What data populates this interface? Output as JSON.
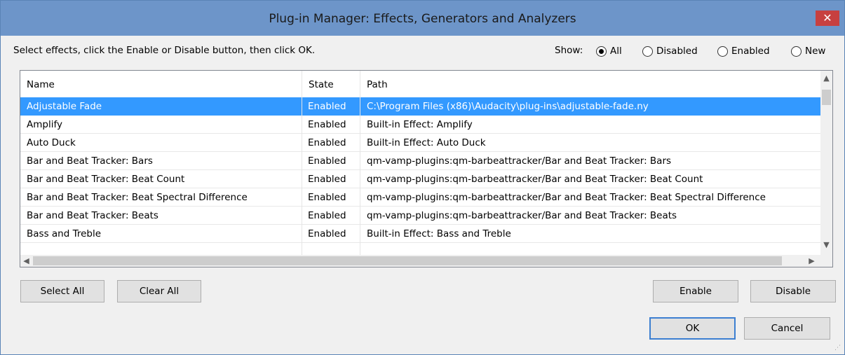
{
  "window": {
    "title": "Plug-in Manager: Effects, Generators and Analyzers",
    "close_glyph": "✕"
  },
  "instructions": "Select effects, click the Enable or Disable button, then click OK.",
  "show": {
    "label": "Show:",
    "options": [
      {
        "label": "All",
        "selected": true
      },
      {
        "label": "Disabled",
        "selected": false
      },
      {
        "label": "Enabled",
        "selected": false
      },
      {
        "label": "New",
        "selected": false
      }
    ]
  },
  "table": {
    "columns": [
      "Name",
      "State",
      "Path"
    ],
    "rows": [
      {
        "name": "Adjustable Fade",
        "state": "Enabled",
        "path": "C:\\Program Files (x86)\\Audacity\\plug-ins\\adjustable-fade.ny",
        "selected": true
      },
      {
        "name": "Amplify",
        "state": "Enabled",
        "path": "Built-in Effect: Amplify",
        "selected": false
      },
      {
        "name": "Auto Duck",
        "state": "Enabled",
        "path": "Built-in Effect: Auto Duck",
        "selected": false
      },
      {
        "name": "Bar and Beat Tracker: Bars",
        "state": "Enabled",
        "path": "qm-vamp-plugins:qm-barbeattracker/Bar and Beat Tracker: Bars",
        "selected": false
      },
      {
        "name": "Bar and Beat Tracker: Beat Count",
        "state": "Enabled",
        "path": "qm-vamp-plugins:qm-barbeattracker/Bar and Beat Tracker: Beat Count",
        "selected": false
      },
      {
        "name": "Bar and Beat Tracker: Beat Spectral Difference",
        "state": "Enabled",
        "path": "qm-vamp-plugins:qm-barbeattracker/Bar and Beat Tracker: Beat Spectral Difference",
        "selected": false
      },
      {
        "name": "Bar and Beat Tracker: Beats",
        "state": "Enabled",
        "path": "qm-vamp-plugins:qm-barbeattracker/Bar and Beat Tracker: Beats",
        "selected": false
      },
      {
        "name": "Bass and Treble",
        "state": "Enabled",
        "path": "Built-in Effect: Bass and Treble",
        "selected": false
      }
    ]
  },
  "buttons": {
    "select_all": "Select All",
    "clear_all": "Clear All",
    "enable": "Enable",
    "disable": "Disable",
    "ok": "OK",
    "cancel": "Cancel"
  },
  "colors": {
    "titlebar": "#6d95c9",
    "selection": "#3399ff",
    "close": "#c74040"
  },
  "icons": [
    "close-icon",
    "scroll-up-icon",
    "scroll-down-icon",
    "scroll-left-icon",
    "scroll-right-icon",
    "resize-grip-icon"
  ]
}
